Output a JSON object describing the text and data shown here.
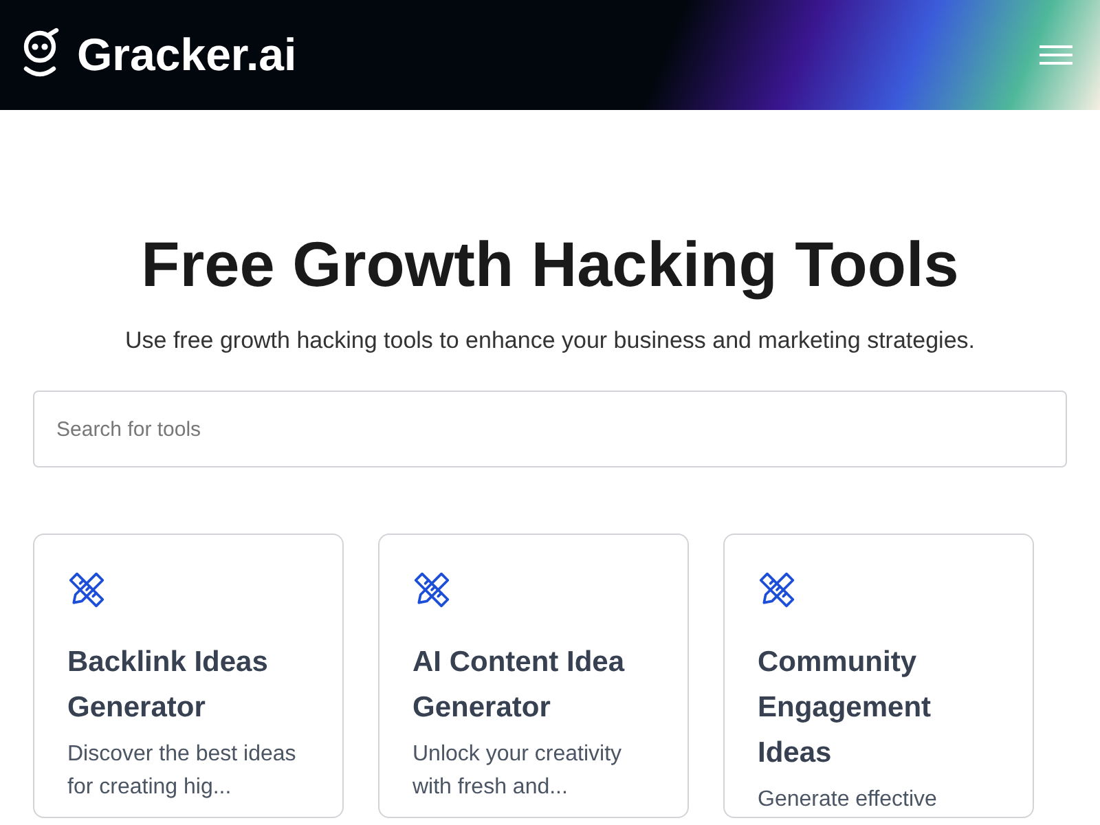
{
  "header": {
    "brand": "Gracker.ai"
  },
  "hero": {
    "title": "Free Growth Hacking Tools",
    "subtitle": "Use free growth hacking tools to enhance your business and marketing strategies."
  },
  "search": {
    "placeholder": "Search for tools"
  },
  "tools": [
    {
      "title": "Backlink Ideas Generator",
      "description": "Discover the best ideas for creating hig..."
    },
    {
      "title": "AI Content Idea Generator",
      "description": "Unlock your creativity with fresh and..."
    },
    {
      "title": "Community Engagement Ideas",
      "description": "Generate effective"
    }
  ]
}
